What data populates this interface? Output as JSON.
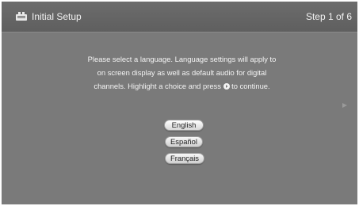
{
  "header": {
    "title": "Initial Setup",
    "step": "Step 1 of 6",
    "icon": "setup-icon"
  },
  "instructions": {
    "line1": "Please select a language. Language settings will apply to",
    "line2": "on screen display as well as default audio for digital",
    "line3_before": "channels.  Highlight a choice and press",
    "line3_after": "to continue."
  },
  "languages": {
    "options": [
      "English",
      "Español",
      "Français"
    ],
    "selected": "English"
  },
  "colors": {
    "background": "#7a7a7a",
    "header": "#626262",
    "text": "#f4f4f4"
  }
}
